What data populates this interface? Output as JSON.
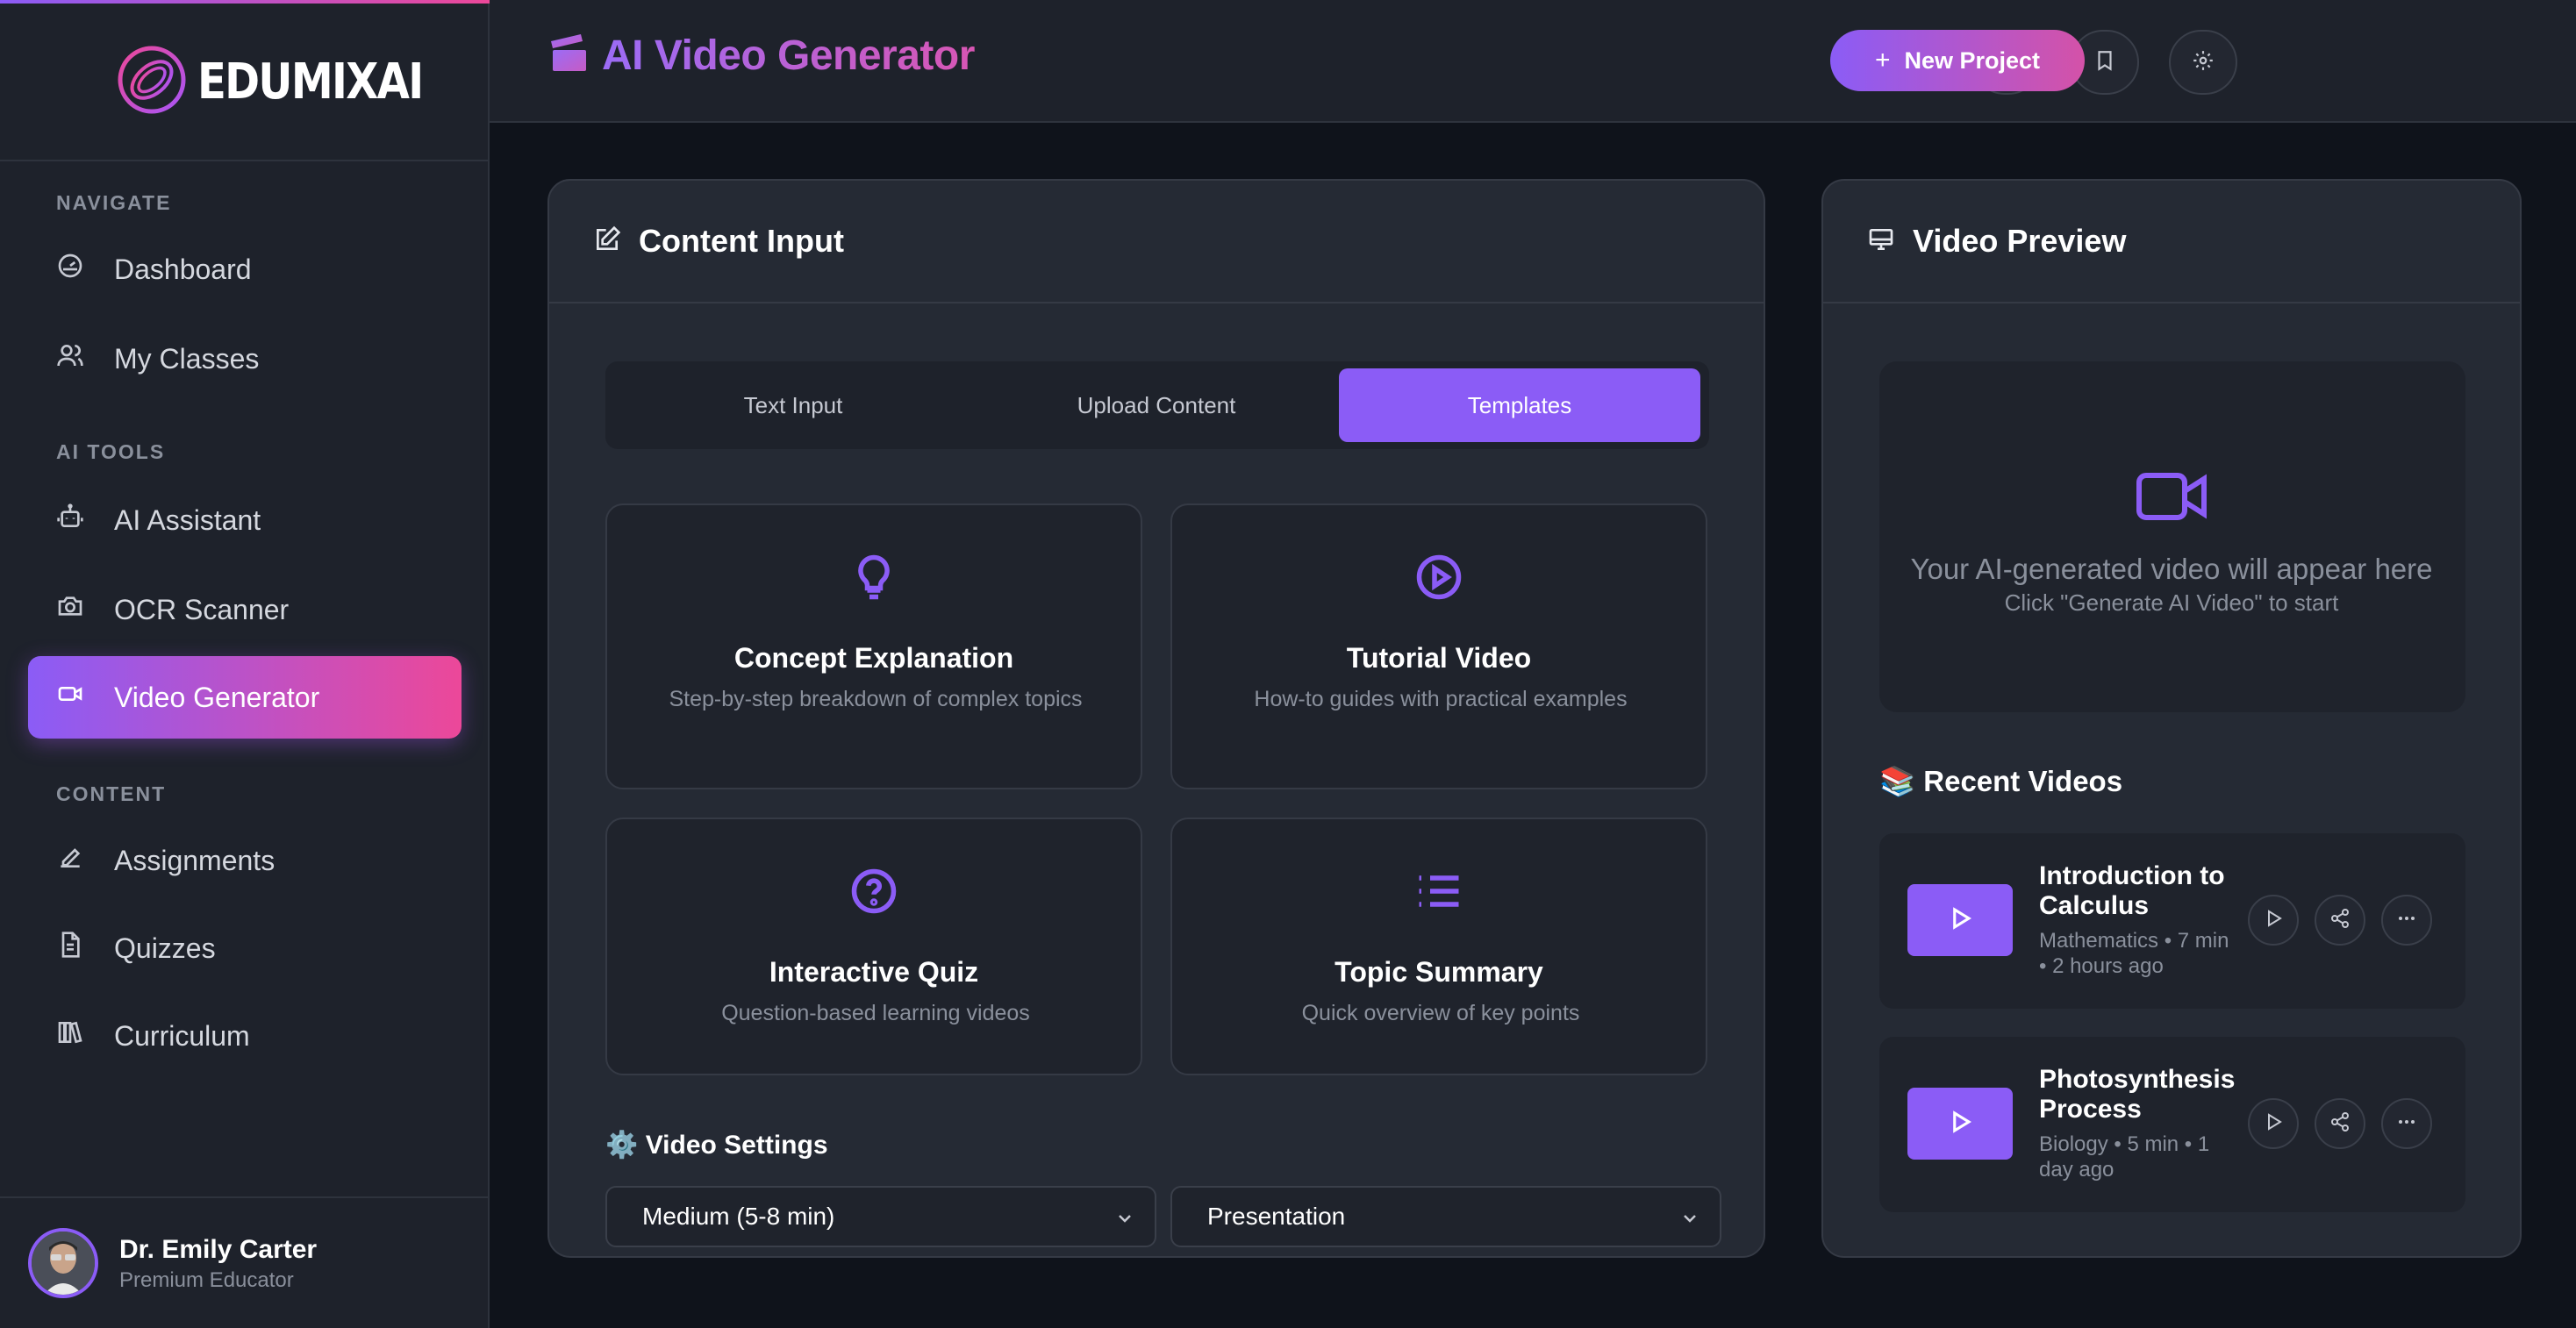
{
  "brand": {
    "name": "EDUMIXAI"
  },
  "sidebar": {
    "sections": [
      "NAVIGATE",
      "AI TOOLS",
      "CONTENT"
    ],
    "items": [
      {
        "label": "Dashboard",
        "icon": "gauge-icon"
      },
      {
        "label": "My Classes",
        "icon": "users-icon"
      },
      {
        "label": "AI Assistant",
        "icon": "robot-icon"
      },
      {
        "label": "OCR Scanner",
        "icon": "camera-icon"
      },
      {
        "label": "Video Generator",
        "icon": "video-icon",
        "active": true
      },
      {
        "label": "Assignments",
        "icon": "pencil-icon"
      },
      {
        "label": "Quizzes",
        "icon": "document-icon"
      },
      {
        "label": "Curriculum",
        "icon": "books-icon"
      }
    ],
    "user": {
      "name": "Dr. Emily Carter",
      "role": "Premium Educator"
    }
  },
  "header": {
    "title": "AI Video Generator",
    "new_project_label": "New Project",
    "icon_buttons": [
      "history-icon",
      "bookmark-icon",
      "gear-icon"
    ]
  },
  "content_input": {
    "title": "Content Input",
    "tabs": [
      {
        "label": "Text Input"
      },
      {
        "label": "Upload Content"
      },
      {
        "label": "Templates",
        "active": true
      }
    ],
    "templates": [
      {
        "title": "Concept Explanation",
        "desc": "Step-by-step breakdown of complex topics",
        "icon": "lightbulb-icon"
      },
      {
        "title": "Tutorial Video",
        "desc": "How-to guides with practical examples",
        "icon": "play-circle-icon"
      },
      {
        "title": "Interactive Quiz",
        "desc": "Question-based learning videos",
        "icon": "question-circle-icon"
      },
      {
        "title": "Topic Summary",
        "desc": "Quick overview of key points",
        "icon": "list-icon"
      }
    ],
    "settings_title": "⚙️ Video Settings",
    "duration_value": "Medium (5-8 min)",
    "style_value": "Presentation"
  },
  "video_preview": {
    "title": "Video Preview",
    "placeholder_main": "Your AI-generated video will appear here",
    "placeholder_sub": "Click \"Generate AI Video\" to start",
    "recent_title": "📚 Recent Videos",
    "recent": [
      {
        "title": "Introduction to Calculus",
        "meta_line1": "Mathematics • 7 min",
        "meta_line2": "• 2 hours ago"
      },
      {
        "title": "Photosynthesis Process",
        "meta_line1": "Biology • 5 min • 1",
        "meta_line2": "day ago"
      }
    ]
  },
  "colors": {
    "accent": "#8b5cf6",
    "accent_pink": "#ec4899",
    "background": "#0f131b",
    "panel": "#252a34",
    "sidebar": "#1e222b"
  }
}
